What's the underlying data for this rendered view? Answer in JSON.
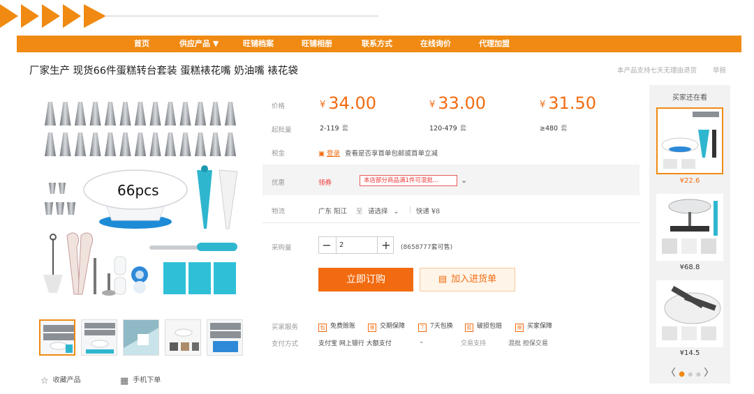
{
  "nav": {
    "items": [
      "首页",
      "供应产品 ▼",
      "旺铺档案",
      "旺铺相册",
      "联系方式",
      "在线询价",
      "代理加盟"
    ]
  },
  "product": {
    "title": "厂家生产 现货66件蛋糕转台套装 蛋糕裱花嘴 奶油嘴 裱花袋",
    "image_text": "66pcs"
  },
  "top_right": {
    "note": "本产品支持七天无理由退货",
    "report": "举报"
  },
  "pricing": {
    "price_label": "价格",
    "batch_label": "起批量",
    "currency": "¥",
    "tiers": [
      {
        "price": "34.00",
        "range": "2-119",
        "unit": "套"
      },
      {
        "price": "33.00",
        "range": "120-479",
        "unit": "套"
      },
      {
        "price": "31.50",
        "range": "≥480",
        "unit": "套"
      }
    ]
  },
  "tax": {
    "label": "税金",
    "link": "登录",
    "text": "查看是否享首单包邮或首单立减"
  },
  "promo": {
    "label": "优惠",
    "coupon": "领券",
    "tag": "本店部分商品满1件可混批..."
  },
  "logistics": {
    "label": "物流",
    "from": "广东 阳江",
    "to_word": "至",
    "select": "请选择",
    "shipping": "快递 ¥8"
  },
  "purchase": {
    "label": "采购量",
    "quantity": "2",
    "stock": "(8658777套可售)",
    "buy_label": "立即订购",
    "cart_label": "加入进货单"
  },
  "services": {
    "label": "买家服务",
    "items": [
      {
        "icon": "包",
        "text": "免费赊账"
      },
      {
        "icon": "保",
        "text": "交期保障"
      },
      {
        "icon": "7",
        "text": "7天包换"
      },
      {
        "icon": "损",
        "text": "破损包赔"
      },
      {
        "icon": "保",
        "text": "买家保障"
      }
    ]
  },
  "payment": {
    "label": "支付方式",
    "methods": "支付宝  网上银行  大额支付",
    "trade": "交易支持",
    "mix": "混批  担保交易"
  },
  "bottom": {
    "favorite": "收藏产品",
    "mobile": "手机下单"
  },
  "side": {
    "title": "买家还在看",
    "items": [
      {
        "price": "¥22.6"
      },
      {
        "price": "¥68.8"
      },
      {
        "price": "¥14.5"
      }
    ],
    "prev": "〈",
    "next": "〉"
  },
  "colors": {
    "brand_orange": "#f08a12",
    "price_orange": "#f26b10",
    "promo_red": "#e33333",
    "teal": "#2fb6cf"
  }
}
